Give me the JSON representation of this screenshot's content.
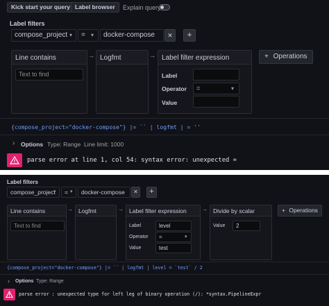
{
  "panel1": {
    "toolbar": {
      "kick_start": "Kick start your query",
      "label_browser": "Label browser",
      "explain_query": "Explain query"
    },
    "label_filters_title": "Label filters",
    "filter": {
      "key": "compose_project",
      "operator": "=",
      "value": "docker-compose"
    },
    "cards": {
      "line_contains": {
        "title": "Line contains",
        "placeholder": "Text to find"
      },
      "logfmt": {
        "title": "Logfmt"
      },
      "label_filter": {
        "title": "Label filter expression",
        "label_label": "Label",
        "label_value": "",
        "operator_label": "Operator",
        "operator_value": "=",
        "value_label": "Value",
        "value_value": ""
      }
    },
    "operations_button": "Operations",
    "query": "{compose_project=\"docker-compose\"} |= `` | logfmt | = ''",
    "options": {
      "label": "Options",
      "type": "Type: Range",
      "line_limit": "Line limit: 1000"
    },
    "error": "parse error at line 1, col 54: syntax error: unexpected ="
  },
  "panel2": {
    "label_filters_title": "Label filters",
    "filter": {
      "key": "compose_project",
      "operator": "=",
      "value": "docker-compose"
    },
    "cards": {
      "line_contains": {
        "title": "Line contains",
        "placeholder": "Text to find"
      },
      "logfmt": {
        "title": "Logfmt"
      },
      "label_filter": {
        "title": "Label filter expression",
        "label_label": "Label",
        "label_value": "level",
        "operator_label": "Operator",
        "operator_value": "=",
        "value_label": "Value",
        "value_value": "test"
      },
      "divide": {
        "title": "Divide by scalar",
        "value_label": "Value",
        "value_value": "2"
      }
    },
    "operations_button": "Operations",
    "query": "{compose_project=\"docker-compose\"} |= `` | logfmt | level = `test` / 2",
    "options": {
      "label": "Options",
      "type": "Type: Range"
    },
    "error": "parse error : unexpected type for left leg of binary operation (/): *syntax.PipelineExpr"
  },
  "icons": {
    "chevron_down": "▾",
    "chevron_right": "›",
    "close": "✕",
    "plus": "+",
    "arrow": "→",
    "warning": "warning-triangle-icon"
  },
  "colors": {
    "background": "#111217",
    "error_accent": "#e0226e",
    "query_blue": "#6e9fff"
  }
}
